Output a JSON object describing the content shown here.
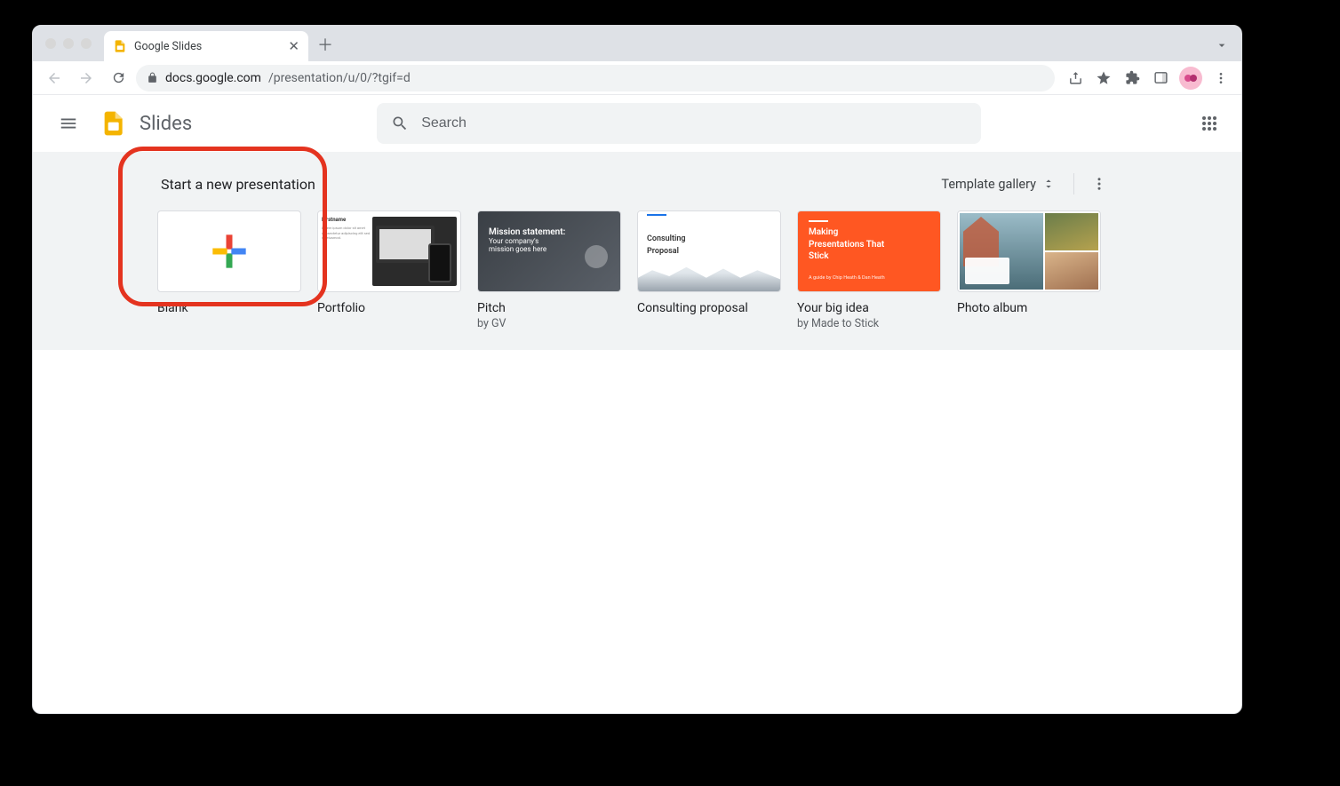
{
  "browser": {
    "tab_title": "Google Slides",
    "url_host": "docs.google.com",
    "url_path": "/presentation/u/0/?tgif=d"
  },
  "app": {
    "title": "Slides",
    "search_placeholder": "Search"
  },
  "gallery": {
    "heading": "Start a new presentation",
    "template_gallery_label": "Template gallery",
    "items": [
      {
        "title": "Blank",
        "subtitle": ""
      },
      {
        "title": "Portfolio",
        "subtitle": ""
      },
      {
        "title": "Pitch",
        "subtitle": "by GV"
      },
      {
        "title": "Consulting proposal",
        "subtitle": ""
      },
      {
        "title": "Your big idea",
        "subtitle": "by Made to Stick"
      },
      {
        "title": "Photo album",
        "subtitle": ""
      }
    ]
  },
  "thumb_text": {
    "portfolio_name": "Firstname",
    "pitch_line1": "Mission statement:",
    "pitch_line2": "Your company's",
    "pitch_line3": "mission goes here",
    "consult_line1": "Consulting",
    "consult_line2": "Proposal",
    "idea_line1": "Making",
    "idea_line2": "Presentations That",
    "idea_line3": "Stick",
    "idea_sub": "A guide by Chip Heath & Dan Heath"
  }
}
